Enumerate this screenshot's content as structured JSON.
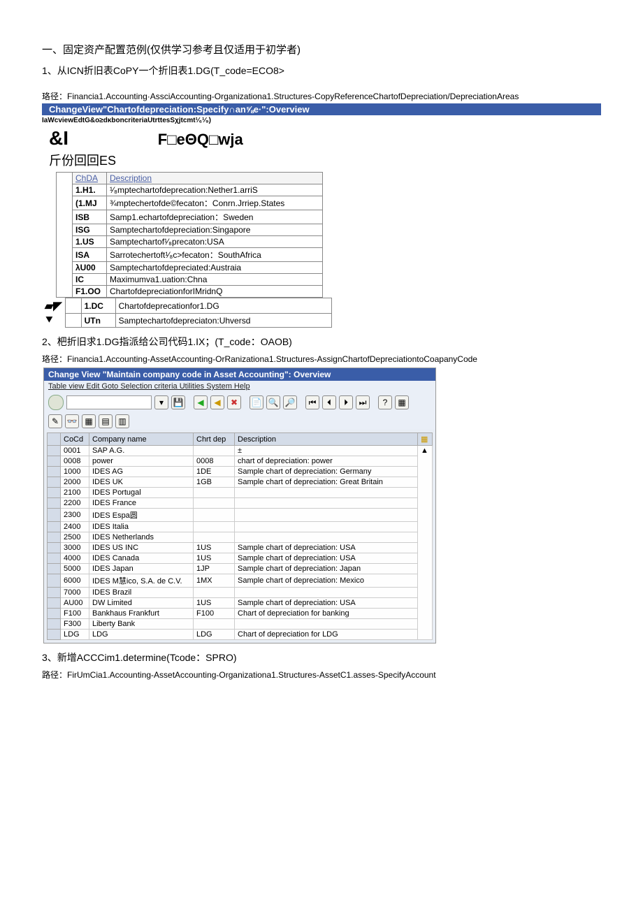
{
  "heading": "一、固定资产配置范例(仅供学习参考且仅适用于初学者)",
  "step1": "1、从ICN折旧表CoPY一个折旧表1.DG(T_code=ECO8>",
  "path1": "珞径：Financia1.Accounting·AssciAccounting-Organizationa1.Structures-CopyReferenceChartofDepreciation/DepreciationAreas",
  "bluebar1": "ChangeView\"Chartofdepreciation:Specify∩an⅝e·\":Overview",
  "garbled1": "IaWcviewEdtG&o≥dκboncriteriaUtrttesSχjtcmt¹⁄₆¹⁄₉)",
  "big1": "&I",
  "big1b": "F□eΘQ□wja",
  "big2": "斤份回回ES",
  "t1_headers": {
    "chda": "ChDA",
    "desc": "Description"
  },
  "t1_rows": [
    {
      "c": "1.H1.",
      "d": "¹⁄₈mptechartofdeprecation:Nether1.arriS",
      "a": ""
    },
    {
      "c": "(1.MJ",
      "d": "¾mptechertofde©fecaton：Conrn.Jrriep.States",
      "a": ""
    },
    {
      "c": "ISB",
      "d": "Samp1.echartofdepreciation：Sweden",
      "a": ""
    },
    {
      "c": "ISG",
      "d": "Samptechartofdepreciation:Singapore",
      "a": ""
    },
    {
      "c": "1.US",
      "d": "Samptechartof¹⁄₈precaton:USA",
      "a": ""
    },
    {
      "c": "ISA",
      "d": "Sarrotechertoft¹⁄₈c>fecaton：SouthAfrica",
      "a": ""
    },
    {
      "c": "λU00",
      "d": "Samptechartofdepreciated:Austraia",
      "a": ""
    },
    {
      "c": "IC",
      "d": "Maximumva1.uation:Chna",
      "a": ""
    },
    {
      "c": "F1.OO",
      "d": "ChartofdepreciationforIMridnQ",
      "a": ""
    },
    {
      "c": "1.DC",
      "d": "Chartofdeprecationfor1.DG",
      "a": "▰◤"
    },
    {
      "c": "UTn",
      "d": "Samptechartofdepreciaton:Uhversd",
      "a": "⯆"
    }
  ],
  "step2": "2、杷折旧求1.DG指派给公司代码1.IX；(T_code：OAOB)",
  "path2": "珞径：Financia1.Accounting-AssetAccounting-OrRanizationa1.Structures-AssignChartofDepreciationtoCoapanyCode",
  "sap_title": "Change View \"Maintain company code in Asset Accounting\": Overview",
  "sap_menu": "Table view   Edit   Goto   Selection criteria   Utilities   System   Help",
  "t2_headers": {
    "coco": "CoCd",
    "name": "Company name",
    "chrt": "Chrt dep",
    "desc": "Description"
  },
  "t2_rows": [
    {
      "co": "0001",
      "nm": "SAP A.G.",
      "cd": "",
      "ds": "±"
    },
    {
      "co": "0008",
      "nm": "power",
      "cd": "0008",
      "ds": "chart of depreciation: power"
    },
    {
      "co": "1000",
      "nm": "IDES AG",
      "cd": "1DE",
      "ds": "Sample chart of depreciation: Germany"
    },
    {
      "co": "2000",
      "nm": "IDES UK",
      "cd": "1GB",
      "ds": "Sample chart of depreciation: Great Britain"
    },
    {
      "co": "2100",
      "nm": "IDES Portugal",
      "cd": "",
      "ds": ""
    },
    {
      "co": "2200",
      "nm": "IDES France",
      "cd": "",
      "ds": ""
    },
    {
      "co": "2300",
      "nm": "IDES Espa圆",
      "cd": "",
      "ds": ""
    },
    {
      "co": "2400",
      "nm": "IDES Italia",
      "cd": "",
      "ds": ""
    },
    {
      "co": "2500",
      "nm": "IDES Netherlands",
      "cd": "",
      "ds": ""
    },
    {
      "co": "3000",
      "nm": "IDES US INC",
      "cd": "1US",
      "ds": "Sample chart of depreciation: USA"
    },
    {
      "co": "4000",
      "nm": "IDES Canada",
      "cd": "1US",
      "ds": "Sample chart of depreciation: USA"
    },
    {
      "co": "5000",
      "nm": "IDES Japan",
      "cd": "1JP",
      "ds": "Sample chart of depreciation: Japan"
    },
    {
      "co": "6000",
      "nm": "IDES M慧ico, S.A. de C.V.",
      "cd": "1MX",
      "ds": "Sample chart of depreciation: Mexico"
    },
    {
      "co": "7000",
      "nm": "IDES Brazil",
      "cd": "",
      "ds": ""
    },
    {
      "co": "AU00",
      "nm": "DW Limited",
      "cd": "1US",
      "ds": "Sample chart of depreciation: USA"
    },
    {
      "co": "F100",
      "nm": "Bankhaus Frankfurt",
      "cd": "F100",
      "ds": "Chart of depreciation for banking"
    },
    {
      "co": "F300",
      "nm": "Liberty Bank",
      "cd": "",
      "ds": ""
    },
    {
      "co": "LDG",
      "nm": "LDG",
      "cd": "LDG",
      "ds": "Chart of depreciation for LDG"
    }
  ],
  "step3": "3、新增ACCCim1.determine(Tcode：SPRO)",
  "path3": "路径：FirUmCia1.Accounting-AssetAccounting-Organizationa1.Structures-AssetC1.asses-SpecifyAccount",
  "icons": {
    "check": "✔",
    "save": "💾",
    "back": "◀",
    "fwd": "▶",
    "x": "✖",
    "t1": "📄",
    "t2": "🔍",
    "t3": "🔎",
    "t4": "📥",
    "t5": "📤",
    "t6": "📑",
    "t7": "❓",
    "pencil": "✎",
    "glasses": "👓",
    "g1": "▦",
    "g2": "▤",
    "g3": "▥"
  }
}
